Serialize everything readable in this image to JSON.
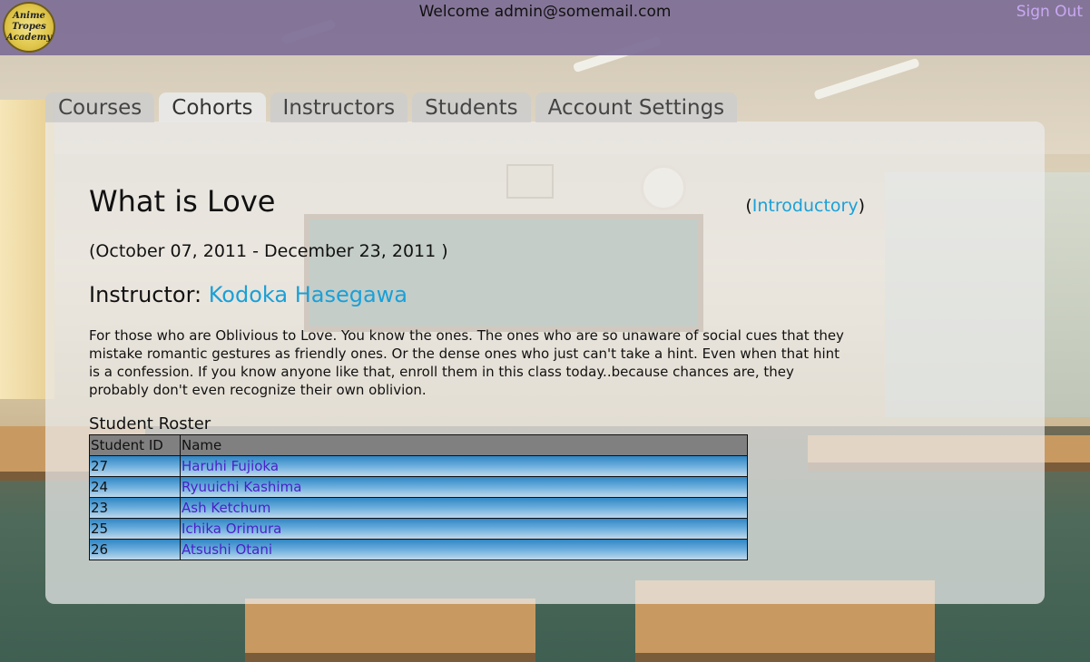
{
  "header": {
    "logo_line1": "Anime Tropes",
    "logo_line2": "Academy",
    "welcome": "Welcome admin@somemail.com",
    "sign_out": "Sign Out"
  },
  "tabs": [
    {
      "label": "Courses",
      "active": false
    },
    {
      "label": "Cohorts",
      "active": true
    },
    {
      "label": "Instructors",
      "active": false
    },
    {
      "label": "Students",
      "active": false
    },
    {
      "label": "Account Settings",
      "active": false
    }
  ],
  "cohort": {
    "title": "What is Love",
    "level": "Introductory",
    "dates": "(October 07, 2011 - December 23, 2011 )",
    "instructor_label": "Instructor:",
    "instructor_name": "Kodoka Hasegawa",
    "description": "For those who are Oblivious to Love. You know the ones. The ones who are so unaware of social cues that they mistake romantic gestures as friendly ones. Or the dense ones who just can't take a hint. Even when that hint is a confession. If you know anyone like that, enroll them in this class today..because chances are, they probably don't even recognize their own oblivion."
  },
  "roster": {
    "title": "Student Roster",
    "headers": {
      "id": "Student ID",
      "name": "Name"
    },
    "rows": [
      {
        "id": "27",
        "name": "Haruhi Fujioka"
      },
      {
        "id": "24",
        "name": "Ryuuichi Kashima"
      },
      {
        "id": "23",
        "name": "Ash Ketchum"
      },
      {
        "id": "25",
        "name": "Ichika Orimura"
      },
      {
        "id": "26",
        "name": "Atsushi Otani"
      }
    ]
  },
  "colors": {
    "header_bg": "#7d6e96",
    "sign_out": "#c9a8f2",
    "link": "#1aa0d8",
    "student_link": "#4b1fc9",
    "table_header": "#808080"
  }
}
